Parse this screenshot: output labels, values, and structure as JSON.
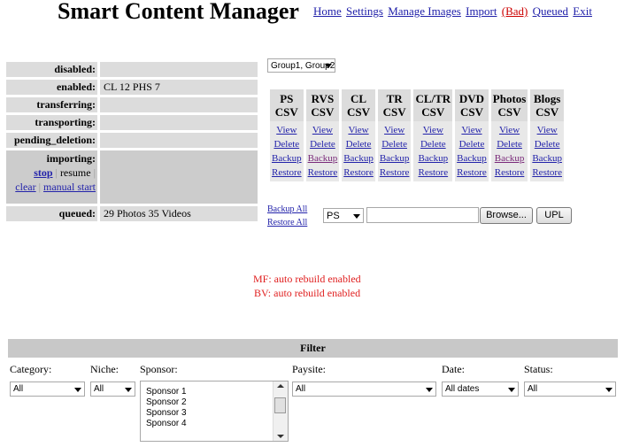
{
  "header": {
    "title": "Smart Content Manager",
    "nav": {
      "home": "Home",
      "settings": "Settings",
      "manage_images": "Manage Images",
      "import": "Import",
      "bad": "(Bad)",
      "queued": "Queued",
      "exit": "Exit"
    }
  },
  "status": {
    "disabled_label": "disabled:",
    "disabled_value": "",
    "enabled_label": "enabled:",
    "enabled_value": "CL 12 PHS 7",
    "transferring_label": "transferring:",
    "transporting_label": "transporting:",
    "pending_label": "pending_deletion:",
    "importing_label": "importing:",
    "importing_stop": "stop",
    "importing_resume": "resume",
    "importing_clear": "clear",
    "importing_manual": "manual start",
    "queued_label": "queued:",
    "queued_value": "29 Photos 35 Videos"
  },
  "group_select": {
    "value": "Group1, Group2"
  },
  "csv": {
    "columns": [
      {
        "line1": "PS",
        "line2": "CSV"
      },
      {
        "line1": "RVS",
        "line2": "CSV"
      },
      {
        "line1": "CL",
        "line2": "CSV"
      },
      {
        "line1": "TR",
        "line2": "CSV"
      },
      {
        "line1": "CL/TR",
        "line2": "CSV"
      },
      {
        "line1": "DVD",
        "line2": "CSV"
      },
      {
        "line1": "Photos",
        "line2": "CSV"
      },
      {
        "line1": "Blogs",
        "line2": "CSV"
      }
    ],
    "actions": [
      "View",
      "Delete",
      "Backup",
      "Restore"
    ]
  },
  "upload": {
    "backup_all": "Backup All",
    "restore_all": "Restore All",
    "type_value": "PS",
    "file_value": "",
    "browse_label": "Browse...",
    "upl_label": "UPL"
  },
  "messages": {
    "mf": "MF: auto rebuild enabled",
    "bv": "BV: auto rebuild enabled"
  },
  "filter": {
    "title": "Filter",
    "category_label": "Category:",
    "category_value": "All",
    "niche_label": "Niche:",
    "niche_value": "All",
    "sponsor_label": "Sponsor:",
    "sponsors": [
      "Sponsor 1",
      "Sponsor 2",
      "Sponsor 3",
      "Sponsor 4"
    ],
    "paysite_label": "Paysite:",
    "paysite_value": "All",
    "date_label": "Date:",
    "date_value": "All dates",
    "status_label": "Status:",
    "status_value": "All"
  },
  "colors": {
    "message_red": "#e02020",
    "link_blue": "#2222aa",
    "visited_purple": "#7a2a7a",
    "cell_gray": "#dcdcdc"
  }
}
